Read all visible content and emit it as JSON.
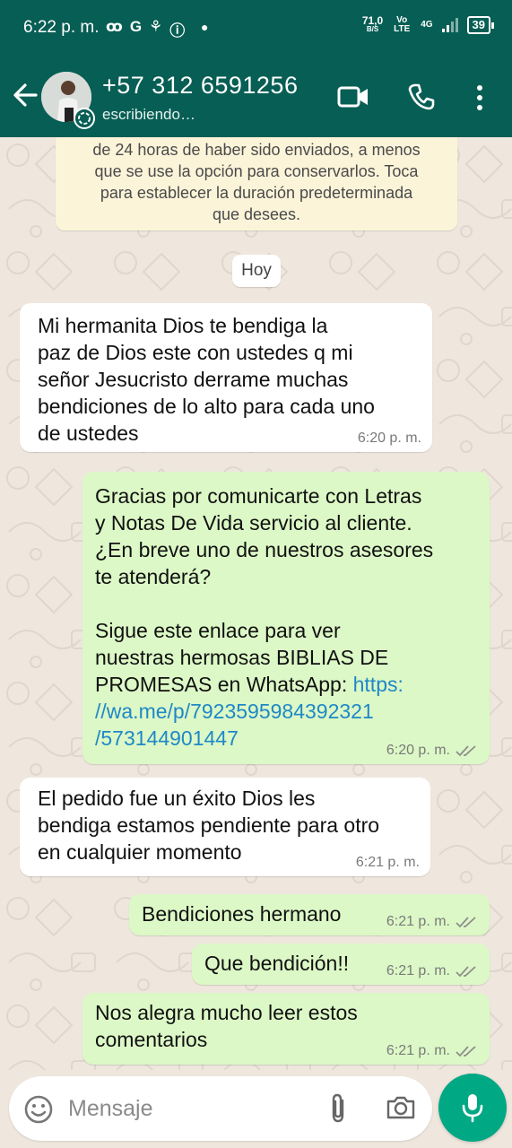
{
  "status_bar": {
    "time": "6:22 p. m.",
    "left_icons": [
      "ꝏ",
      "G",
      "⚘",
      "ⓘ"
    ],
    "net_speed": "71,0",
    "net_unit": "B/S",
    "network": "Vo LTE",
    "signal": "4G",
    "battery": "39"
  },
  "header": {
    "contact_name": "+57 312 6591256",
    "status": "escribiendo…"
  },
  "chat": {
    "system_notice": "de 24 horas de haber sido enviados, a menos\nque se use la opción para conservarlos. Toca\npara establecer la duración predeterminada\nque desees.",
    "day_label": "Hoy",
    "messages": [
      {
        "direction": "in",
        "text": "Mi hermanita Dios te bendiga la\npaz de Dios este con ustedes q mi\nseñor Jesucristo derrame muchas\nbendiciones de lo alto para cada uno\nde ustedes",
        "time": "6:20 p. m."
      },
      {
        "direction": "out",
        "text": "Gracias por comunicarte con Letras\ny Notas De Vida servicio al cliente.\n¿En breve uno de nuestros asesores\nte atenderá?\n\nSigue este enlace para ver\nnuestras hermosas BIBLIAS DE\nPROMESAS en WhatsApp: ",
        "link": "https:\n//wa.me/p/7923595984392321\n/573144901447",
        "time": "6:20 p. m."
      },
      {
        "direction": "in",
        "text": "El pedido fue un éxito Dios les\nbendiga estamos pendiente para otro\nen cualquier momento",
        "time": "6:21 p. m."
      },
      {
        "direction": "out",
        "text": "Bendiciones hermano",
        "time": "6:21 p. m."
      },
      {
        "direction": "out",
        "text": "Que bendición!!",
        "time": "6:21 p. m."
      },
      {
        "direction": "out",
        "text": "Nos alegra mucho leer estos\ncomentarios",
        "time": "6:21 p. m."
      }
    ]
  },
  "input": {
    "placeholder": "Mensaje"
  },
  "colors": {
    "header": "#075e54",
    "outgoing_bubble": "#dcf8c6",
    "incoming_bubble": "#ffffff",
    "link": "#1f88c8",
    "mic_button": "#00a884",
    "read_ticks": "#8d8d8d"
  }
}
